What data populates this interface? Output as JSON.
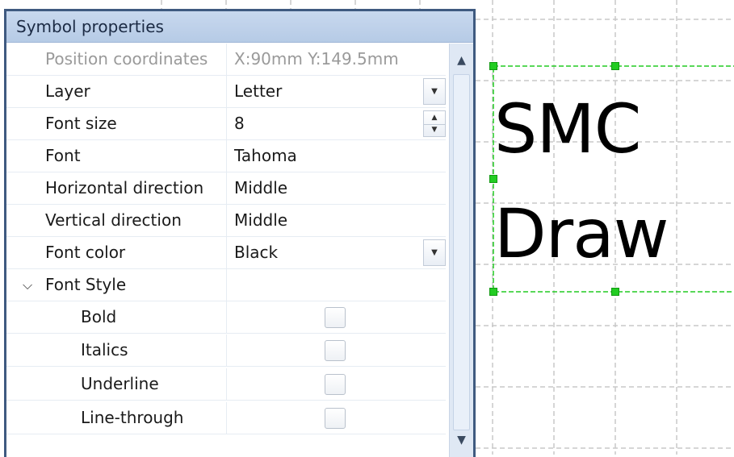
{
  "panel": {
    "title": "Symbol properties",
    "rows": [
      {
        "label": "Position coordinates",
        "value": "X:90mm Y:149.5mm"
      },
      {
        "label": "Layer",
        "value": "Letter"
      },
      {
        "label": "Font size",
        "value": "8"
      },
      {
        "label": "Font",
        "value": "Tahoma"
      },
      {
        "label": "Horizontal direction",
        "value": "Middle"
      },
      {
        "label": "Vertical direction",
        "value": "Middle"
      },
      {
        "label": "Font color",
        "value": "Black"
      },
      {
        "label": "Font Style",
        "value": ""
      }
    ],
    "style_options": [
      {
        "label": "Bold",
        "checked": false
      },
      {
        "label": "Italics",
        "checked": false
      },
      {
        "label": "Underline",
        "checked": false
      },
      {
        "label": "Line-through",
        "checked": false
      }
    ]
  },
  "canvas": {
    "symbol_line1": "SMC",
    "symbol_line2": "Draw",
    "selection_color": "#22cc22"
  },
  "icons": {
    "dropdown": "chevron-down-icon",
    "spinner": "spin-arrows-icon",
    "expand": "chevron-down-icon",
    "scroll_up": "triangle-up-icon",
    "scroll_down": "triangle-down-icon"
  }
}
